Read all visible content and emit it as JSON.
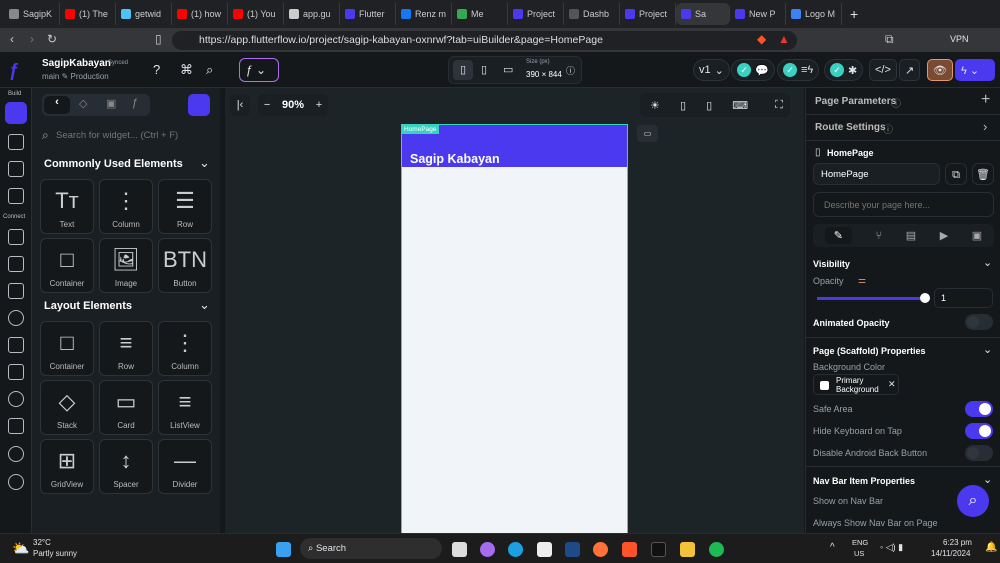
{
  "browser": {
    "tabs": [
      "SagipK",
      "(1) The",
      "getwid",
      "(1) how",
      "(1) You",
      "app.gu",
      "Flutter",
      "Renz m",
      "Me",
      "Project",
      "Dashb",
      "Project",
      "Sa",
      "New P",
      "Logo M"
    ],
    "url": "https://app.flutterflow.io/project/sagip-kabayan-oxnrwf?tab=uiBuilder&page=HomePage",
    "vpn": "VPN"
  },
  "header": {
    "project": "SagipKabayan",
    "synced": "Synced",
    "branch": "main ✎ Production",
    "size_label": "Size (px)",
    "size": "390 × 844",
    "version": "v1"
  },
  "rail": {
    "build": "Build",
    "connect": "Connect"
  },
  "left": {
    "search_placeholder": "Search for widget... (Ctrl + F)",
    "common_title": "Commonly Used Elements",
    "common": [
      {
        "l": "Text",
        "g": "Tт"
      },
      {
        "l": "Column",
        "g": "⋮"
      },
      {
        "l": "Row",
        "g": "☰"
      },
      {
        "l": "Container",
        "g": "□"
      },
      {
        "l": "Image",
        "g": "🖼"
      },
      {
        "l": "Button",
        "g": "BTN"
      }
    ],
    "layout_title": "Layout Elements",
    "layout": [
      {
        "l": "Container",
        "g": "□"
      },
      {
        "l": "Row",
        "g": "≡"
      },
      {
        "l": "Column",
        "g": "⋮"
      },
      {
        "l": "Stack",
        "g": "◇"
      },
      {
        "l": "Card",
        "g": "▭"
      },
      {
        "l": "ListView",
        "g": "≡"
      },
      {
        "l": "GridView",
        "g": "⊞"
      },
      {
        "l": "Spacer",
        "g": "↕"
      },
      {
        "l": "Divider",
        "g": "—"
      }
    ]
  },
  "canvas": {
    "zoom": "90%",
    "page_tag": "HomePage",
    "app_title": "Sagip Kabayan"
  },
  "right": {
    "page_params": "Page Parameters",
    "route": "Route Settings",
    "page": "HomePage",
    "page_name": "HomePage",
    "desc_placeholder": "Describe your page here...",
    "visibility": "Visibility",
    "opacity": "Opacity",
    "opacity_value": "1",
    "opacity_fraction": 1,
    "animated_opacity": "Animated Opacity",
    "scaffold": "Page (Scaffold) Properties",
    "bg_color": "Background Color",
    "bg_value": "Primary Background",
    "safe_area": "Safe Area",
    "hide_kb": "Hide Keyboard on Tap",
    "disable_back": "Disable Android Back Button",
    "nav": "Nav Bar Item Properties",
    "show_nav": "Show on Nav Bar",
    "always_nav": "Always Show Nav Bar on Page"
  },
  "taskbar": {
    "temp": "32°C",
    "weather": "Partly sunny",
    "search": "Search",
    "lang": "ENG",
    "region": "US",
    "time": "6:23 pm",
    "date": "14/11/2024"
  },
  "colors": {
    "accent": "#4b39ef",
    "teal": "#39d2c0"
  }
}
